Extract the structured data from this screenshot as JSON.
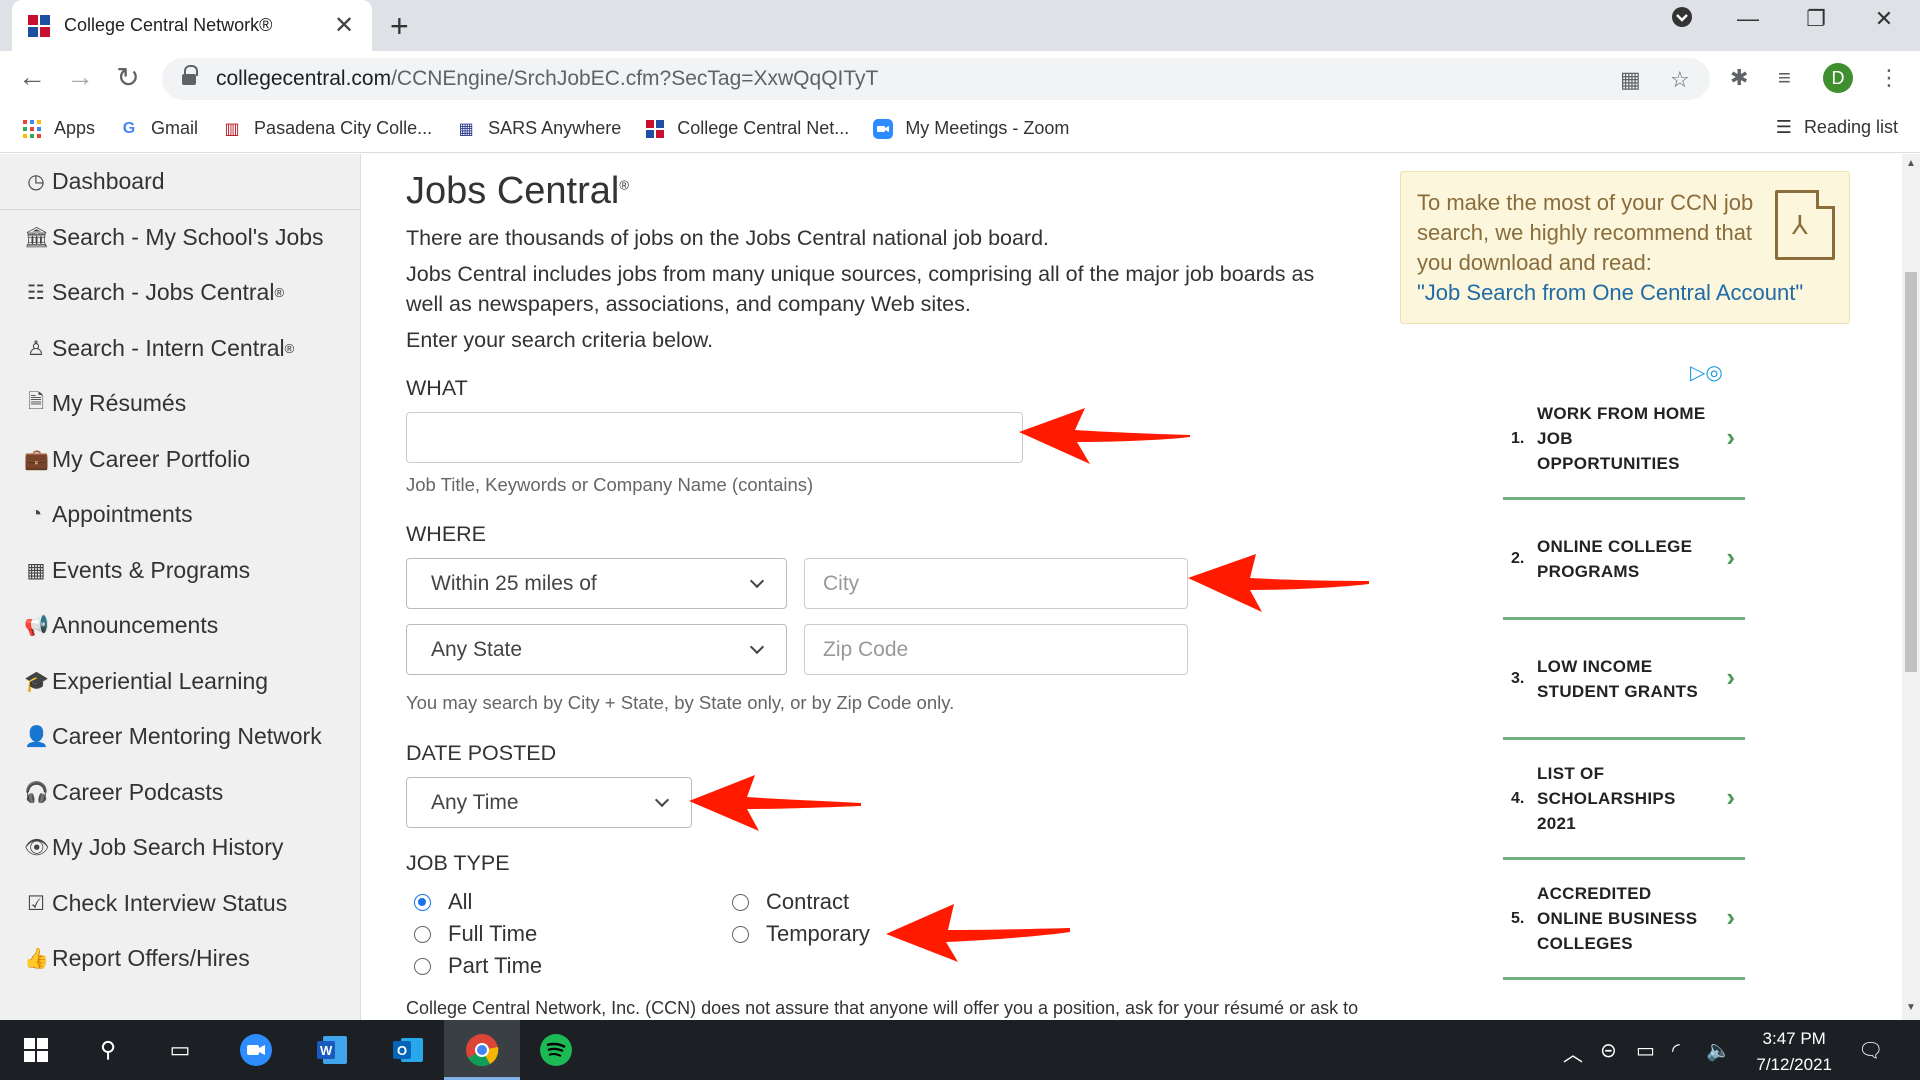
{
  "browser": {
    "tab_title": "College Central Network®",
    "url_host": "collegecentral.com",
    "url_path": "/CCNEngine/SrchJobEC.cfm?SecTag=XxwQqQITyT",
    "avatar_letter": "D",
    "bookmarks": [
      "Apps",
      "Gmail",
      "Pasadena City Colle...",
      "SARS Anywhere",
      "College Central Net...",
      "My Meetings - Zoom"
    ],
    "reading_list": "Reading list"
  },
  "sidebar": {
    "items": [
      {
        "label": "Dashboard",
        "sup": "",
        "icon": "dashboard-icon"
      },
      {
        "label": "Search - My School's Jobs",
        "sup": "",
        "icon": "institution-icon"
      },
      {
        "label": "Search - Jobs Central",
        "sup": "®",
        "icon": "newspaper-icon"
      },
      {
        "label": "Search - Intern Central",
        "sup": "®",
        "icon": "intern-icon"
      },
      {
        "label": "My Résumés",
        "sup": "",
        "icon": "document-icon"
      },
      {
        "label": "My Career Portfolio",
        "sup": "",
        "icon": "briefcase-icon"
      },
      {
        "label": "Appointments",
        "sup": "",
        "icon": "clock-icon"
      },
      {
        "label": "Events & Programs",
        "sup": "",
        "icon": "calendar-icon"
      },
      {
        "label": "Announcements",
        "sup": "",
        "icon": "megaphone-icon"
      },
      {
        "label": "Experiential Learning",
        "sup": "",
        "icon": "graduation-cap-icon"
      },
      {
        "label": "Career Mentoring Network",
        "sup": "",
        "icon": "user-icon"
      },
      {
        "label": "Career Podcasts",
        "sup": "",
        "icon": "headphones-icon"
      },
      {
        "label": "My Job Search History",
        "sup": "",
        "icon": "eye-icon"
      },
      {
        "label": "Check Interview Status",
        "sup": "",
        "icon": "checkbox-icon"
      },
      {
        "label": "Report Offers/Hires",
        "sup": "",
        "icon": "thumbs-up-icon"
      }
    ]
  },
  "main": {
    "title": "Jobs Central",
    "title_sup": "®",
    "intro1": "There are thousands of jobs on the Jobs Central national job board.",
    "intro2": "Jobs Central includes jobs from many unique sources, comprising all of the major job boards as well as newspapers, associations, and company Web sites.",
    "intro3": "Enter your search criteria below.",
    "what_label": "WHAT",
    "what_value": "",
    "what_help": "Job Title, Keywords or Company Name (contains)",
    "where_label": "WHERE",
    "distance_selected": "Within 25 miles of",
    "city_placeholder": "City",
    "state_selected": "Any State",
    "zip_placeholder": "Zip Code",
    "where_help": "You may search by City + State, by State only, or by Zip Code only.",
    "date_label": "DATE POSTED",
    "date_selected": "Any Time",
    "jobtype_label": "JOB TYPE",
    "jobtypes": [
      {
        "label": "All",
        "checked": true
      },
      {
        "label": "Full Time",
        "checked": false
      },
      {
        "label": "Part Time",
        "checked": false
      },
      {
        "label": "Contract",
        "checked": false
      },
      {
        "label": "Temporary",
        "checked": false
      }
    ],
    "footer": "College Central Network, Inc. (CCN) does not assure that anyone will offer you a position, ask for your résumé or ask to"
  },
  "recommend": {
    "text": "To make the most of your CCN job search, we highly recommend that you download and read:",
    "link": "\"Job Search from One Central Account\""
  },
  "ads": [
    {
      "num": "1.",
      "text": "WORK FROM HOME JOB OPPORTUNITIES"
    },
    {
      "num": "2.",
      "text": "ONLINE COLLEGE PROGRAMS"
    },
    {
      "num": "3.",
      "text": "LOW INCOME STUDENT GRANTS"
    },
    {
      "num": "4.",
      "text": "LIST OF SCHOLARSHIPS 2021"
    },
    {
      "num": "5.",
      "text": "ACCREDITED ONLINE BUSINESS COLLEGES"
    }
  ],
  "taskbar": {
    "time": "3:47 PM",
    "date": "7/12/2021"
  },
  "colors": {
    "annotation_arrow": "#ff1a00",
    "ad_divider": "#6fb081",
    "link": "#1f6ba8"
  }
}
